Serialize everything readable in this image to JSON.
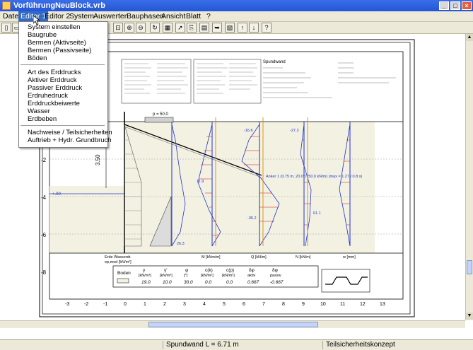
{
  "window": {
    "title": "VorführungNeuBlock.vrb"
  },
  "menubar": {
    "items": [
      "Datei",
      "Editor 1",
      "Editor 2",
      "System",
      "Auswerten",
      "Bauphasen",
      "Ansicht",
      "Blatt",
      "?"
    ]
  },
  "dropdown": {
    "group1": [
      "System einstellen",
      "Baugrube",
      "Bermen (Aktivseite)",
      "Bermen (Passivseite)",
      "Böden"
    ],
    "group2": [
      "Art des Erddrucks",
      "Aktiver Erddruck",
      "Passiver Erddruck",
      "Erdruhedruck",
      "Erddruckbeiwerte",
      "Wasser",
      "Erdbeben"
    ],
    "group3": [
      "Nachweise / Teilsicherheiten",
      "Auftrieb + Hydr. Grundbruch"
    ]
  },
  "drawing": {
    "y_ticks": [
      "-2",
      "-4",
      "-6",
      "-8"
    ],
    "x_ticks": [
      "-3",
      "-2",
      "-1",
      "0",
      "1",
      "2",
      "3",
      "4",
      "5",
      "6",
      "7",
      "8",
      "9",
      "10",
      "11",
      "12",
      "13"
    ],
    "dim_label": "3.50",
    "load_label": "p = 50.0",
    "left_level": "+.00",
    "spundwand": "Spundwand",
    "anker_label": "Anker 1 (0.75 m, 20.0°) (50.0 kN/m) (max = 1.27 / 0.8 s)",
    "diagram_titles": [
      "Erde Wasserdr.",
      "ep,mod [kN/m²]",
      "M [kNm/m]",
      "Q [kN/m]",
      "N [kN/m]",
      "w [mm]"
    ],
    "max_values": [
      "26.3",
      "-35.2",
      "61.1",
      "-27.3",
      "11.9",
      "-16.6"
    ],
    "soil_table": {
      "headers": [
        "Boden",
        "γ",
        "γ'",
        "φ",
        "c(k)",
        "c(p)",
        "δφ",
        "δφ"
      ],
      "units": [
        "",
        "[kN/m³]",
        "[kN/m³]",
        "[°]",
        "[kN/m²]",
        "[kN/m²]",
        "aktiv",
        "passiv"
      ],
      "values": [
        "",
        "19.0",
        "10.0",
        "30.0",
        "0.0",
        "0.0",
        "0.667",
        "-0.667"
      ]
    }
  },
  "status": {
    "left": "",
    "middle": "Spundwand   L = 6.71 m",
    "right": "Teilsicherheitskonzept"
  },
  "colors": {
    "titlebar": "#2456d6",
    "menu_highlight": "#316ac5",
    "drawing_blue": "#2233cc",
    "drawing_red": "#cc1111",
    "ground": "#f3f2e2"
  }
}
